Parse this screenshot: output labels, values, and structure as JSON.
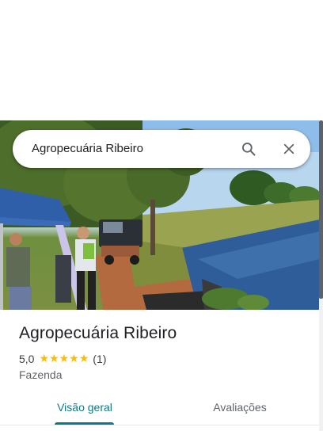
{
  "search": {
    "value": "Agropecuária Ribeiro",
    "search_icon": "search-icon",
    "clear_icon": "close-icon"
  },
  "place": {
    "name": "Agropecuária Ribeiro",
    "rating": "5,0",
    "rating_stars": 5,
    "review_count": "(1)",
    "category": "Fazenda",
    "photo_alt": "Agropecuária Ribeiro"
  },
  "tabs": [
    {
      "label": "Visão geral",
      "selected": true
    },
    {
      "label": "Avaliações",
      "selected": false
    }
  ],
  "colors": {
    "accent": "#0b7a8a",
    "star": "#fbbc04",
    "text_primary": "#202124",
    "text_secondary": "#5f6368"
  }
}
